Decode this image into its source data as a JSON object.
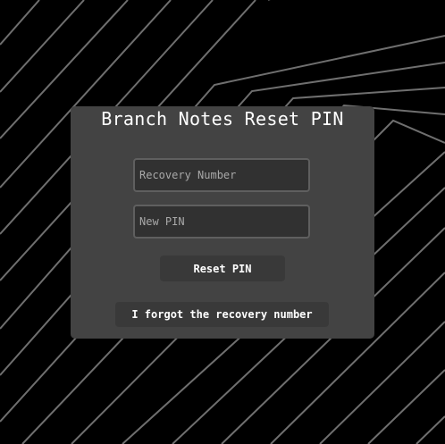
{
  "dialog": {
    "title": "Branch Notes Reset PIN"
  },
  "form": {
    "recovery_placeholder": "Recovery Number",
    "recovery_value": "",
    "pin_placeholder": "New PIN",
    "pin_value": "",
    "reset_label": "Reset PIN",
    "forgot_label": "I forgot the recovery number"
  },
  "colors": {
    "background": "#000000",
    "panel": "#434343",
    "field": "#313131",
    "button": "#393939",
    "lines": "#6f6f6f"
  }
}
